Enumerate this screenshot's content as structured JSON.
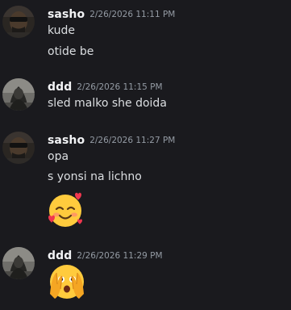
{
  "messages": [
    {
      "author": "sasho",
      "timestamp": "2/26/2026 11:11 PM",
      "lines": [
        "kude",
        "otide be"
      ]
    },
    {
      "author": "ddd",
      "timestamp": "2/26/2026 11:15 PM",
      "lines": [
        "sled malko she doida"
      ]
    },
    {
      "author": "sasho",
      "timestamp": "2/26/2026 11:27 PM",
      "lines": [
        "opa",
        "s yonsi na lichno"
      ],
      "emoji": "smiling-face-with-hearts"
    },
    {
      "author": "ddd",
      "timestamp": "2/26/2026 11:29 PM",
      "emoji": "face-with-peeking-eye"
    }
  ],
  "colors": {
    "background": "#1a1a1e",
    "username": "#f2f3f5",
    "message_text": "#dbdee1",
    "timestamp": "#949ba4",
    "emoji_yellow": "#ffcb3d"
  }
}
